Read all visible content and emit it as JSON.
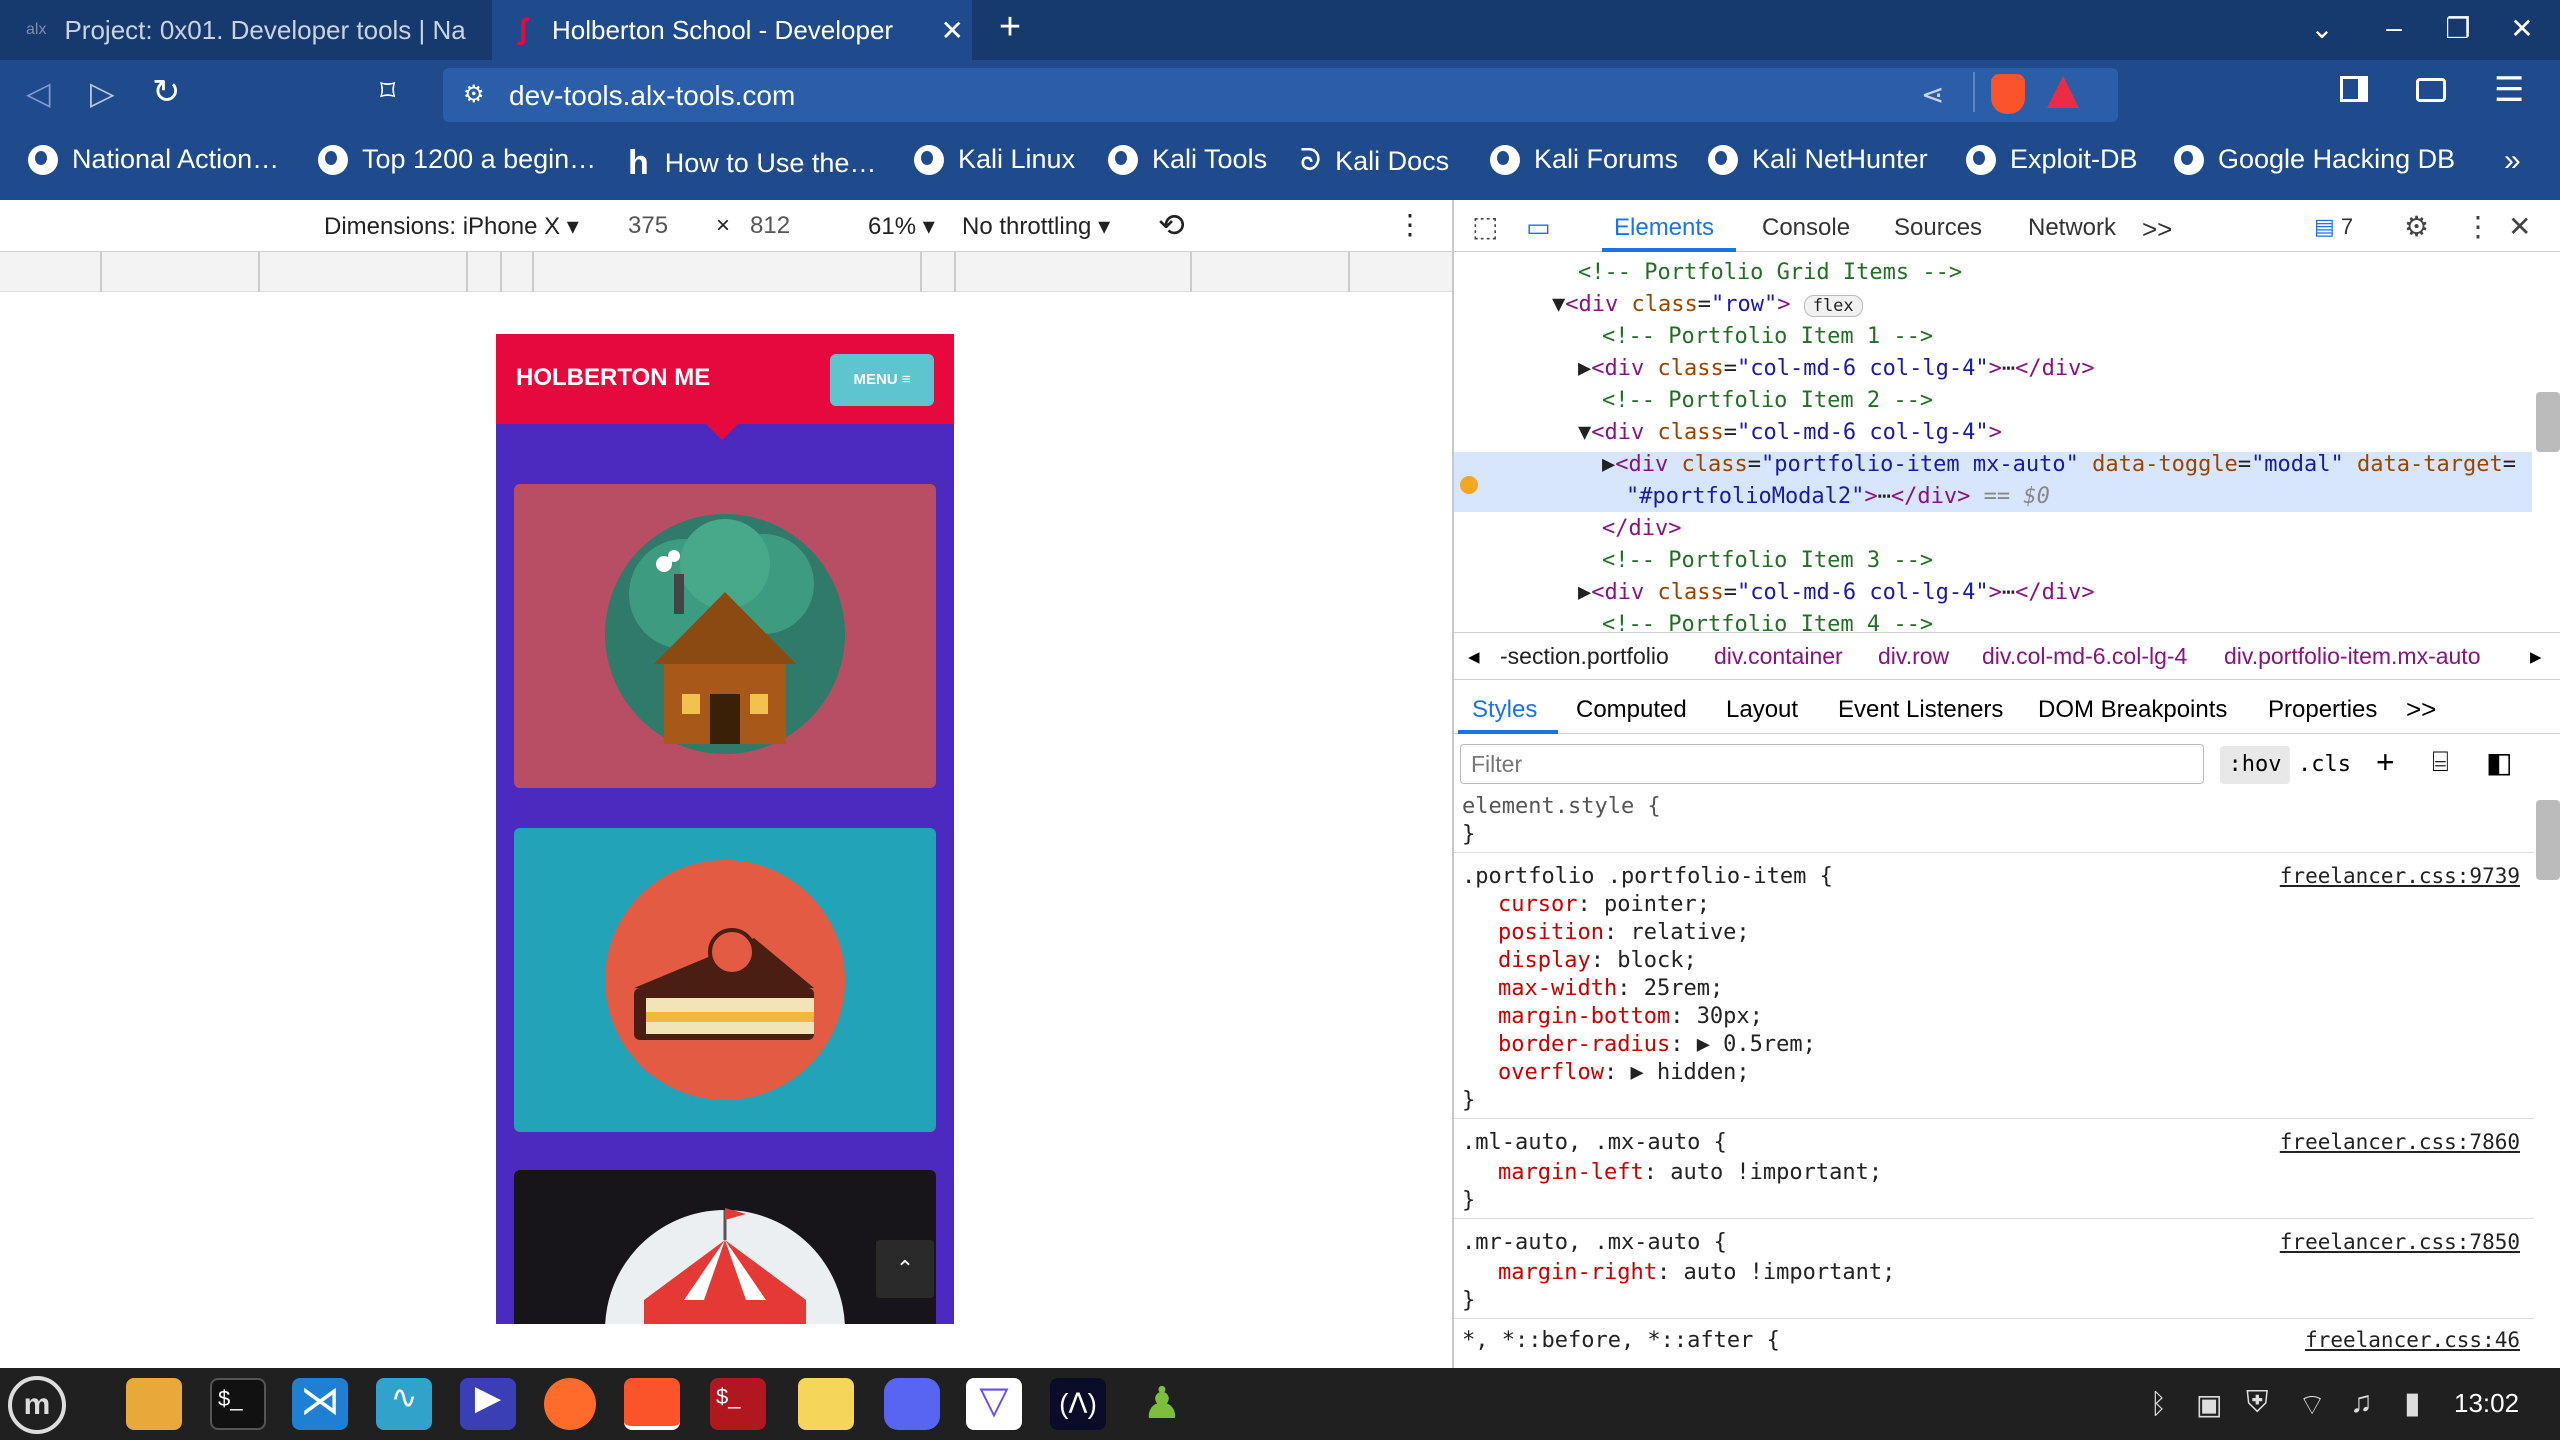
{
  "browser": {
    "tabs": [
      {
        "title": "Project: 0x01. Developer tools | Na",
        "active": false
      },
      {
        "title": "Holberton School - Developer",
        "active": true
      }
    ],
    "url": "dev-tools.alx-tools.com",
    "bookmarks": [
      "National Action…",
      "Top 1200 a begin…",
      "How to Use the…",
      "Kali Linux",
      "Kali Tools",
      "Kali Docs",
      "Kali Forums",
      "Kali NetHunter",
      "Exploit-DB",
      "Google Hacking DB"
    ],
    "bookmarks_more": "»"
  },
  "device_toolbar": {
    "dimensions_label": "Dimensions: iPhone X",
    "width": "375",
    "times": "×",
    "height": "812",
    "zoom": "61%",
    "throttling": "No throttling"
  },
  "phone": {
    "brand": "HOLBERTON ME",
    "menu_label": "MENU",
    "colors": {
      "header": "#e6093d",
      "background": "#4b2bbf",
      "card1": "#b84e64",
      "card2": "#22a3b8",
      "card3": "#17151a"
    }
  },
  "devtools": {
    "tabs": [
      "Elements",
      "Console",
      "Sources",
      "Network"
    ],
    "more": ">>",
    "issues_count": "7",
    "dom_lines": [
      {
        "indent": 0,
        "html": "<!-- Portfolio Grid Items -->",
        "kind": "comment"
      },
      {
        "indent": 0,
        "arrow": "▼",
        "tag": "div",
        "attrs": [
          [
            "class",
            "row"
          ]
        ],
        "badge": "flex"
      },
      {
        "indent": 1,
        "html": "<!-- Portfolio Item 1 -->",
        "kind": "comment"
      },
      {
        "indent": 1,
        "arrow": "▶",
        "tag": "div",
        "attrs": [
          [
            "class",
            "col-md-6 col-lg-4"
          ]
        ],
        "collapsed": true
      },
      {
        "indent": 1,
        "html": "<!-- Portfolio Item 2 -->",
        "kind": "comment"
      },
      {
        "indent": 1,
        "arrow": "▼",
        "tag": "div",
        "attrs": [
          [
            "class",
            "col-md-6 col-lg-4"
          ]
        ]
      },
      {
        "indent": 2,
        "arrow": "▶",
        "tag": "div",
        "attrs": [
          [
            "class",
            "portfolio-item mx-auto"
          ],
          [
            "data-toggle",
            "modal"
          ],
          [
            "data-target",
            "#portfolioModal2"
          ]
        ],
        "collapsed": true,
        "selected": true,
        "eq": "== $0"
      },
      {
        "indent": 1,
        "html": "</div>",
        "kind": "close"
      },
      {
        "indent": 1,
        "html": "<!-- Portfolio Item 3 -->",
        "kind": "comment"
      },
      {
        "indent": 1,
        "arrow": "▶",
        "tag": "div",
        "attrs": [
          [
            "class",
            "col-md-6 col-lg-4"
          ]
        ],
        "collapsed": true
      },
      {
        "indent": 1,
        "html": "<!-- Portfolio Item 4 -->",
        "kind": "comment"
      }
    ],
    "breadcrumbs": [
      "-section.portfolio",
      "div.container",
      "div.row",
      "div.col-md-6.col-lg-4",
      "div.portfolio-item.mx-auto"
    ],
    "subtabs": [
      "Styles",
      "Computed",
      "Layout",
      "Event Listeners",
      "DOM Breakpoints",
      "Properties"
    ],
    "filter_placeholder": "Filter",
    "hov": ":hov",
    "cls": ".cls",
    "rules": [
      {
        "selector": "element.style {",
        "link": "",
        "props": []
      },
      {
        "selector": ".portfolio .portfolio-item {",
        "link": "freelancer.css:9739",
        "props": [
          [
            "cursor",
            "pointer;"
          ],
          [
            "position",
            "relative;"
          ],
          [
            "display",
            "block;"
          ],
          [
            "max-width",
            "25rem;"
          ],
          [
            "margin-bottom",
            "30px;"
          ],
          [
            "border-radius",
            "▶ 0.5rem;"
          ],
          [
            "overflow",
            "▶ hidden;"
          ]
        ]
      },
      {
        "selector": ".ml-auto, .mx-auto {",
        "link": "freelancer.css:7860",
        "props": [
          [
            "margin-left",
            "auto !important;"
          ]
        ]
      },
      {
        "selector": ".mr-auto, .mx-auto {",
        "link": "freelancer.css:7850",
        "props": [
          [
            "margin-right",
            "auto !important;"
          ]
        ]
      },
      {
        "selector": "*, *::before, *::after {",
        "link": "freelancer.css:46",
        "props": []
      }
    ]
  },
  "taskbar": {
    "time": "13:02"
  }
}
